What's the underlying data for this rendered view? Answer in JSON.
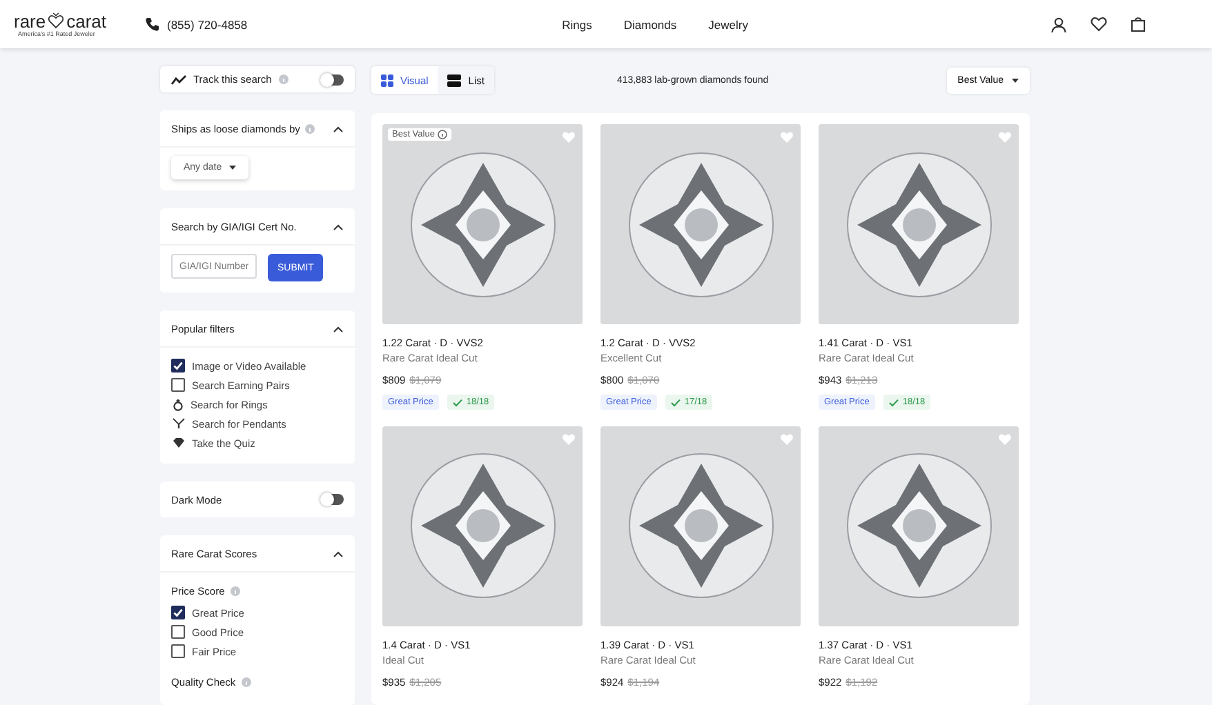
{
  "header": {
    "logo": {
      "left": "rare",
      "right": "carat",
      "tagline": "America's #1 Rated Jeweler"
    },
    "phone": "(855) 720-4858",
    "nav": [
      "Rings",
      "Diamonds",
      "Jewelry"
    ]
  },
  "sidebar": {
    "track": {
      "label": "Track this search",
      "on": false
    },
    "sections": [
      {
        "kind": "dropdown",
        "title": "Ships as loose diamonds by",
        "info": true,
        "expanded": true,
        "value": "Any date"
      },
      {
        "kind": "cert",
        "title": "Search by GIA/IGI Cert No.",
        "info": false,
        "expanded": true,
        "placeholder": "GIA/IGI Number",
        "button": "SUBMIT"
      },
      {
        "kind": "filters",
        "title": "Popular filters",
        "info": false,
        "expanded": true,
        "items": [
          {
            "kind": "checkbox",
            "label": "Image or Video Available",
            "checked": true
          },
          {
            "kind": "checkbox",
            "label": "Search Earning Pairs",
            "checked": false
          },
          {
            "kind": "ring",
            "label": "Search for Rings"
          },
          {
            "kind": "pendant",
            "label": "Search for Pendants"
          },
          {
            "kind": "quiz",
            "label": "Take the Quiz"
          }
        ]
      },
      {
        "kind": "toggle",
        "title": "Dark Mode",
        "on": false
      },
      {
        "kind": "scores",
        "title": "Rare Carat Scores",
        "info": false,
        "expanded": true,
        "groups": [
          {
            "title": "Price Score",
            "items": [
              {
                "label": "Great Price",
                "checked": true
              },
              {
                "label": "Good Price",
                "checked": false
              },
              {
                "label": "Fair Price",
                "checked": false
              }
            ]
          },
          {
            "title": "Quality Check"
          }
        ]
      }
    ]
  },
  "toolbar": {
    "views": [
      {
        "label": "Visual",
        "selected": true
      },
      {
        "label": "List",
        "selected": false
      }
    ],
    "count": "413,883 lab-grown diamonds found",
    "sort": "Best Value"
  },
  "cards": [
    {
      "badge": "Best Value",
      "favorite": false,
      "title": "1.22 Carat · D · VVS2",
      "cut": "Rare Carat Ideal Cut",
      "price": "$809",
      "old_price": "$1,079",
      "price_tag": "Great Price",
      "score": "18/18"
    },
    {
      "favorite": false,
      "title": "1.2 Carat · D · VVS2",
      "cut": "Excellent Cut",
      "price": "$800",
      "old_price": "$1,070",
      "price_tag": "Great Price",
      "score": "17/18"
    },
    {
      "favorite": false,
      "title": "1.41 Carat · D · VS1",
      "cut": "Rare Carat Ideal Cut",
      "price": "$943",
      "old_price": "$1,213",
      "price_tag": "Great Price",
      "score": "18/18"
    },
    {
      "favorite": false,
      "title": "1.4 Carat · D · VS1",
      "cut": "Ideal Cut",
      "price": "$935",
      "old_price": "$1,205"
    },
    {
      "favorite": false,
      "title": "1.39 Carat · D · VS1",
      "cut": "Rare Carat Ideal Cut",
      "price": "$924",
      "old_price": "$1,194"
    },
    {
      "favorite": false,
      "title": "1.37 Carat · D · VS1",
      "cut": "Rare Carat Ideal Cut",
      "price": "$922",
      "old_price": "$1,192"
    }
  ]
}
